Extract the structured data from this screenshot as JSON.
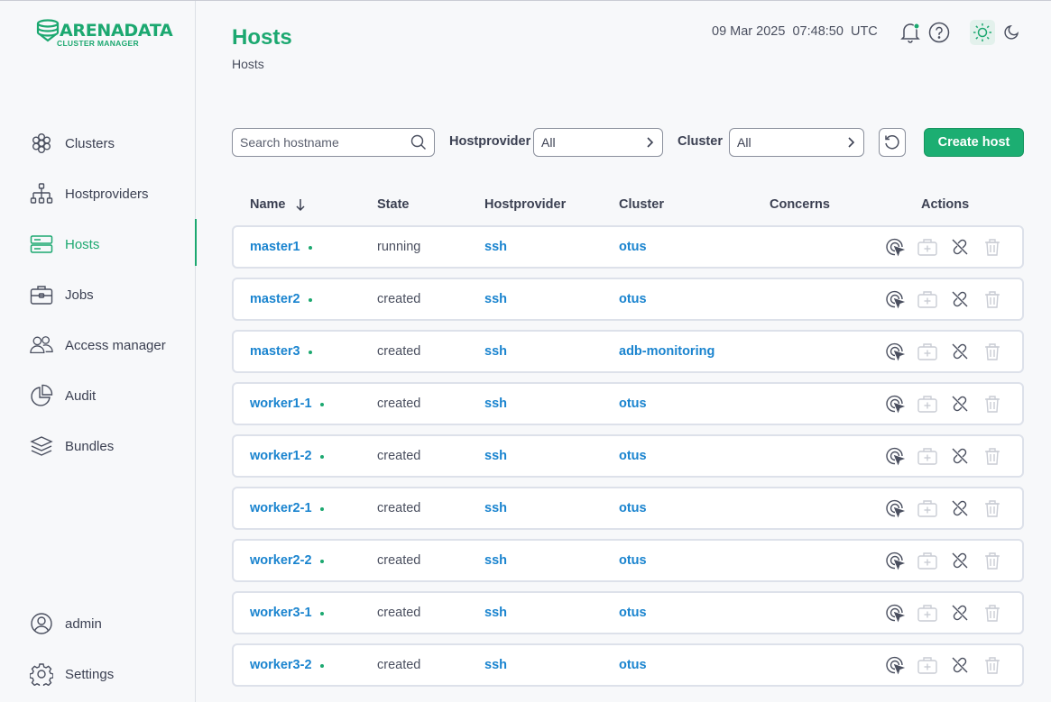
{
  "logo": {
    "title": "ARENADATA",
    "subtitle": "CLUSTER MANAGER"
  },
  "nav": {
    "items": [
      {
        "label": "Clusters",
        "icon": "clusters-icon"
      },
      {
        "label": "Hostproviders",
        "icon": "hostproviders-icon"
      },
      {
        "label": "Hosts",
        "icon": "hosts-icon",
        "active": true
      },
      {
        "label": "Jobs",
        "icon": "jobs-icon"
      },
      {
        "label": "Access manager",
        "icon": "access-manager-icon"
      },
      {
        "label": "Audit",
        "icon": "audit-icon"
      },
      {
        "label": "Bundles",
        "icon": "bundles-icon"
      }
    ],
    "bottom": [
      {
        "label": "admin",
        "icon": "user-icon"
      },
      {
        "label": "Settings",
        "icon": "settings-icon"
      }
    ]
  },
  "header": {
    "title": "Hosts",
    "breadcrumb": "Hosts",
    "datetime": "09 Mar 2025  07:48:50  UTC"
  },
  "toolbar": {
    "search_placeholder": "Search hostname",
    "hostprovider_label": "Hostprovider",
    "hostprovider_value": "All",
    "cluster_label": "Cluster",
    "cluster_value": "All",
    "create_label": "Create host"
  },
  "table": {
    "columns": [
      "Name",
      "State",
      "Hostprovider",
      "Cluster",
      "Concerns",
      "Actions"
    ],
    "rows": [
      {
        "name": "master1",
        "state": "running",
        "hostprovider": "ssh",
        "cluster": "otus"
      },
      {
        "name": "master2",
        "state": "created",
        "hostprovider": "ssh",
        "cluster": "otus"
      },
      {
        "name": "master3",
        "state": "created",
        "hostprovider": "ssh",
        "cluster": "adb-monitoring"
      },
      {
        "name": "worker1-1",
        "state": "created",
        "hostprovider": "ssh",
        "cluster": "otus"
      },
      {
        "name": "worker1-2",
        "state": "created",
        "hostprovider": "ssh",
        "cluster": "otus"
      },
      {
        "name": "worker2-1",
        "state": "created",
        "hostprovider": "ssh",
        "cluster": "otus"
      },
      {
        "name": "worker2-2",
        "state": "created",
        "hostprovider": "ssh",
        "cluster": "otus"
      },
      {
        "name": "worker3-1",
        "state": "created",
        "hostprovider": "ssh",
        "cluster": "otus"
      },
      {
        "name": "worker3-2",
        "state": "created",
        "hostprovider": "ssh",
        "cluster": "otus"
      }
    ]
  },
  "colors": {
    "accent": "#1ca870",
    "link": "#1a84cf",
    "button": "#1cae72"
  }
}
